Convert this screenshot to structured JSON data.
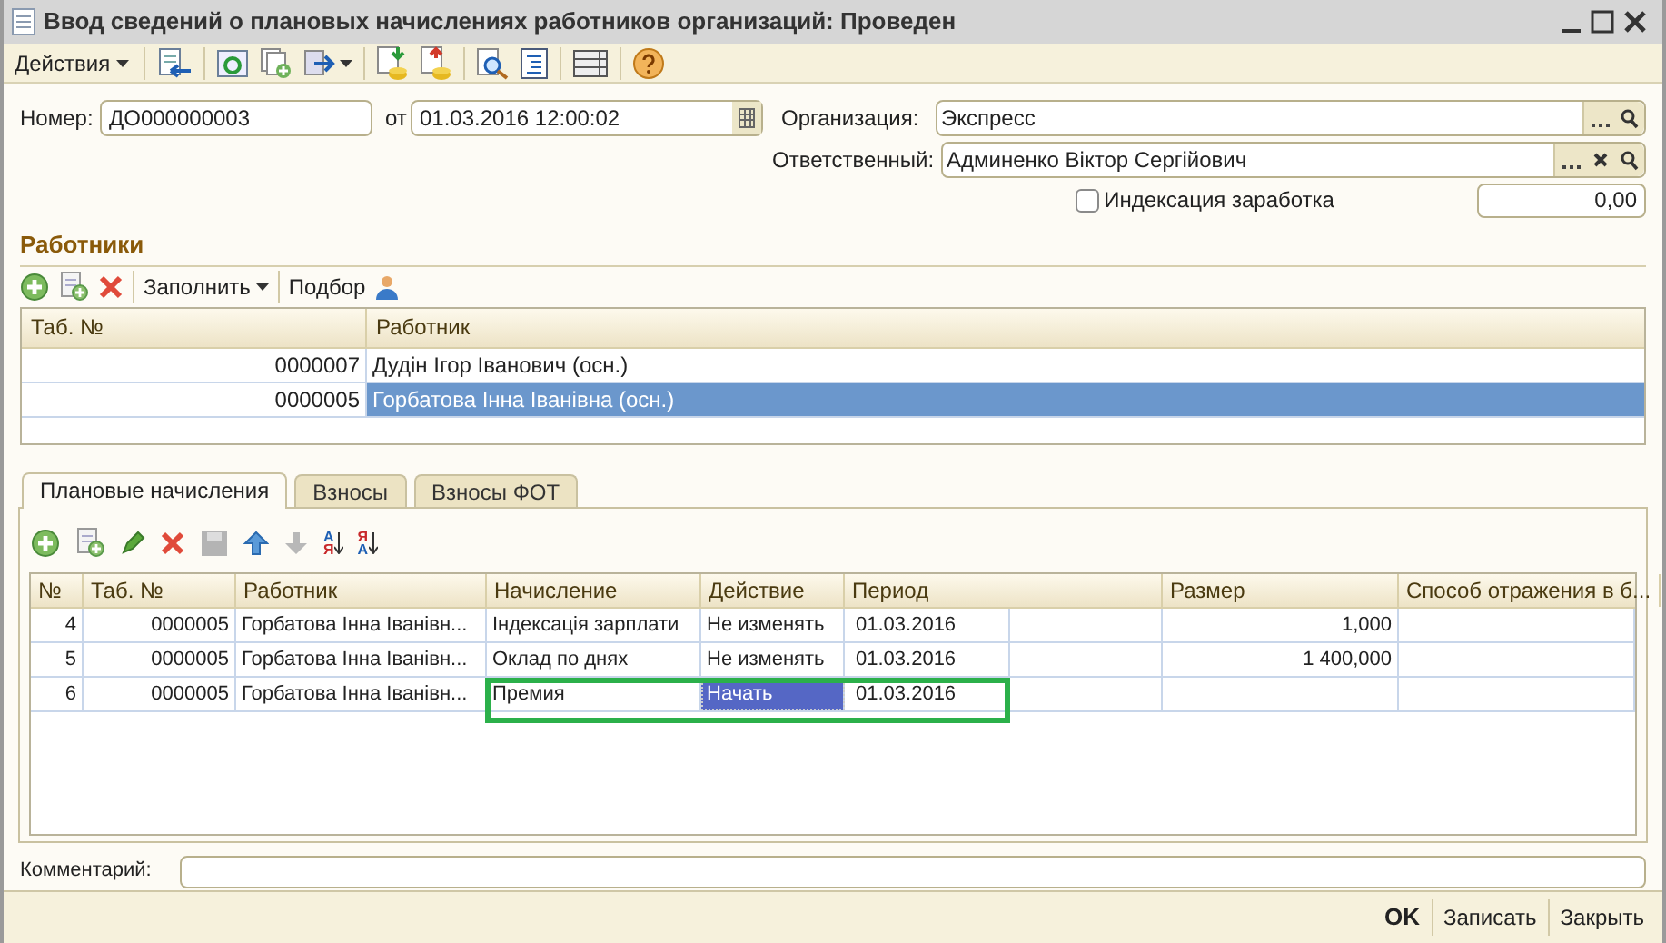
{
  "window": {
    "title": "Ввод сведений о плановых начислениях работников организаций: Проведен"
  },
  "toolbar": {
    "actions_label": "Действия"
  },
  "header": {
    "number_label": "Номер:",
    "number": "ДО000000003",
    "date_label": "от",
    "date": "01.03.2016 12:00:02",
    "organization_label": "Организация:",
    "organization": "Экспресс",
    "responsible_label": "Ответственный:",
    "responsible": "Админенко Віктор Сергійович",
    "indexation": {
      "label": "Индексация заработка",
      "checked": false
    },
    "indexation_amount": "0,00"
  },
  "employees": {
    "title": "Работники",
    "fill_label": "Заполнить",
    "pick_label": "Подбор",
    "columns": [
      "Таб. №",
      "Работник"
    ],
    "rows": [
      {
        "tab_no": "0000007",
        "employee": "Дудін Ігор Іванович (осн.)",
        "selected": false
      },
      {
        "tab_no": "0000005",
        "employee": "Горбатова Інна Іванівна (осн.)",
        "selected": true
      }
    ]
  },
  "tabs": [
    {
      "label": "Плановые начисления",
      "selected": true
    },
    {
      "label": "Взносы",
      "selected": false
    },
    {
      "label": "Взносы ФОТ",
      "selected": false
    }
  ],
  "sort_icons": [
    {
      "top": "А",
      "bottom": "Я"
    },
    {
      "top": "Я",
      "bottom": "А"
    }
  ],
  "accruals": {
    "columns": [
      "№",
      "Таб. №",
      "Работник",
      "Начисление",
      "Действие",
      "Период",
      "Размер",
      "Способ отражения в б..."
    ],
    "rows": [
      {
        "n": "4",
        "tab_no": "0000005",
        "employee": "Горбатова Інна Іванівн...",
        "accrual": "Індексація зарплати",
        "action": "Не изменять",
        "period": "01.03.2016",
        "amount": "1,000",
        "selected": false,
        "highlighted": false
      },
      {
        "n": "5",
        "tab_no": "0000005",
        "employee": "Горбатова Інна Іванівн...",
        "accrual": "Оклад по днях",
        "action": "Не изменять",
        "period": "01.03.2016",
        "amount": "1 400,000",
        "selected": false,
        "highlighted": false
      },
      {
        "n": "6",
        "tab_no": "0000005",
        "employee": "Горбатова Інна Іванівн...",
        "accrual": "Премия",
        "action": "Начать",
        "period": "01.03.2016",
        "selected": true,
        "highlighted": true
      }
    ]
  },
  "comment_label": "Комментарий:",
  "buttons": [
    {
      "label": "OK",
      "kind": "default"
    },
    {
      "label": "Записать",
      "kind": "normal"
    },
    {
      "label": "Закрыть",
      "kind": "normal"
    }
  ]
}
